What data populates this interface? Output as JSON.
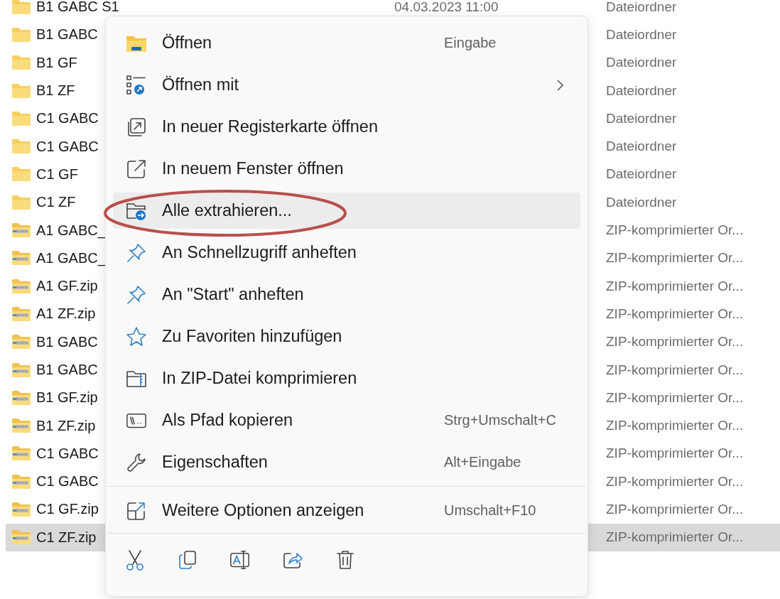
{
  "files": [
    {
      "kind": "folder",
      "name": "B1 GABC S1",
      "date": "04.03.2023 11:00",
      "type": "Dateiordner",
      "selected": false
    },
    {
      "kind": "folder",
      "name": "B1 GABC",
      "type": "Dateiordner",
      "selected": false
    },
    {
      "kind": "folder",
      "name": "B1 GF",
      "type": "Dateiordner",
      "selected": false
    },
    {
      "kind": "folder",
      "name": "B1 ZF",
      "type": "Dateiordner",
      "selected": false
    },
    {
      "kind": "folder",
      "name": "C1 GABC",
      "type": "Dateiordner",
      "selected": false
    },
    {
      "kind": "folder",
      "name": "C1 GABC",
      "type": "Dateiordner",
      "selected": false
    },
    {
      "kind": "folder",
      "name": "C1 GF",
      "type": "Dateiordner",
      "selected": false
    },
    {
      "kind": "folder",
      "name": "C1 ZF",
      "type": "Dateiordner",
      "selected": false
    },
    {
      "kind": "zip",
      "name": "A1 GABC_",
      "type": "ZIP-komprimierter Or...",
      "selected": false
    },
    {
      "kind": "zip",
      "name": "A1 GABC_",
      "type": "ZIP-komprimierter Or...",
      "selected": false
    },
    {
      "kind": "zip",
      "name": "A1 GF.zip",
      "type": "ZIP-komprimierter Or...",
      "selected": false
    },
    {
      "kind": "zip",
      "name": "A1 ZF.zip",
      "type": "ZIP-komprimierter Or...",
      "selected": false
    },
    {
      "kind": "zip",
      "name": "B1 GABC",
      "type": "ZIP-komprimierter Or...",
      "selected": false
    },
    {
      "kind": "zip",
      "name": "B1 GABC",
      "type": "ZIP-komprimierter Or...",
      "selected": false
    },
    {
      "kind": "zip",
      "name": "B1 GF.zip",
      "type": "ZIP-komprimierter Or...",
      "selected": false
    },
    {
      "kind": "zip",
      "name": "B1 ZF.zip",
      "type": "ZIP-komprimierter Or...",
      "selected": false
    },
    {
      "kind": "zip",
      "name": "C1 GABC",
      "type": "ZIP-komprimierter Or...",
      "selected": false
    },
    {
      "kind": "zip",
      "name": "C1 GABC",
      "type": "ZIP-komprimierter Or...",
      "selected": false
    },
    {
      "kind": "zip",
      "name": "C1 GF.zip",
      "type": "ZIP-komprimierter Or...",
      "selected": false
    },
    {
      "kind": "zip",
      "name": "C1 ZF.zip",
      "type": "ZIP-komprimierter Or...",
      "selected": true
    }
  ],
  "context_menu": {
    "items": [
      {
        "label": "Öffnen",
        "shortcut": "Eingabe",
        "submenu": false,
        "highlighted": false,
        "circled": false
      },
      {
        "label": "Öffnen mit",
        "submenu": true,
        "highlighted": false,
        "circled": false
      },
      {
        "label": "In neuer Registerkarte öffnen",
        "submenu": false,
        "highlighted": false,
        "circled": false
      },
      {
        "label": "In neuem Fenster öffnen",
        "submenu": false,
        "highlighted": false,
        "circled": false
      },
      {
        "label": "Alle extrahieren...",
        "submenu": false,
        "highlighted": true,
        "circled": true
      },
      {
        "label": "An Schnellzugriff anheften",
        "submenu": false,
        "highlighted": false,
        "circled": false
      },
      {
        "label": "An \"Start\" anheften",
        "submenu": false,
        "highlighted": false,
        "circled": false
      },
      {
        "label": "Zu Favoriten hinzufügen",
        "submenu": false,
        "highlighted": false,
        "circled": false
      },
      {
        "label": "In ZIP-Datei komprimieren",
        "submenu": false,
        "highlighted": false,
        "circled": false
      },
      {
        "label": "Als Pfad kopieren",
        "shortcut": "Strg+Umschalt+C",
        "submenu": false,
        "highlighted": false,
        "circled": false
      },
      {
        "label": "Eigenschaften",
        "shortcut": "Alt+Eingabe",
        "submenu": false,
        "highlighted": false,
        "circled": false
      }
    ],
    "more_options": {
      "label": "Weitere Optionen anzeigen",
      "shortcut": "Umschalt+F10"
    }
  }
}
